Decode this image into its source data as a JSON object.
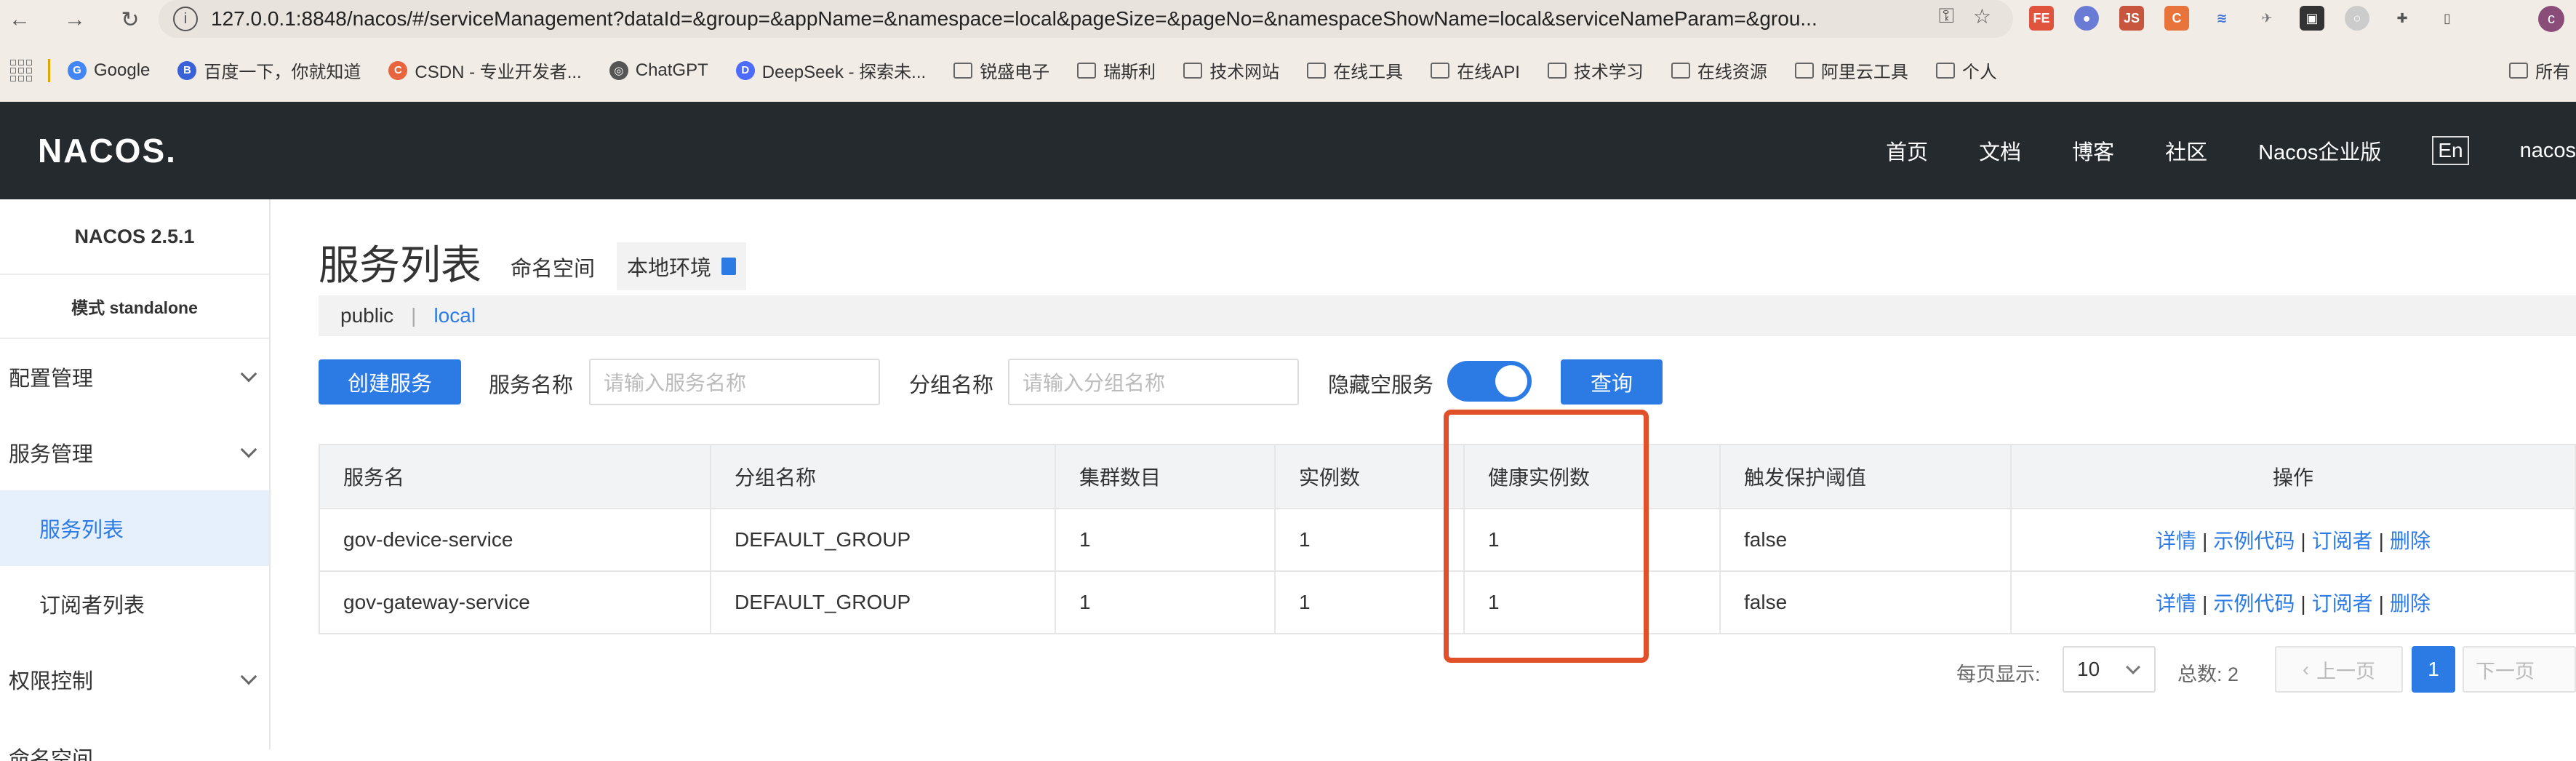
{
  "browser": {
    "url": "127.0.0.1:8848/nacos/#/serviceManagement?dataId=&group=&appName=&namespace=local&pageSize=&pageNo=&namespaceShowName=local&serviceNameParam=&grou...",
    "profile_initial": "c",
    "bookmarks": [
      {
        "label": "Google",
        "kind": "fav",
        "color": "#4285f4",
        "glyph": "G"
      },
      {
        "label": "百度一下，你就知道",
        "kind": "fav",
        "color": "#3a62d8",
        "glyph": "B"
      },
      {
        "label": "CSDN - 专业开发者...",
        "kind": "fav",
        "color": "#e8643c",
        "glyph": "C"
      },
      {
        "label": "ChatGPT",
        "kind": "fav",
        "color": "#555555",
        "glyph": "◎"
      },
      {
        "label": "DeepSeek - 探索未...",
        "kind": "fav",
        "color": "#4d6bfe",
        "glyph": "D"
      },
      {
        "label": "锐盛电子",
        "kind": "folder"
      },
      {
        "label": "瑞斯利",
        "kind": "folder"
      },
      {
        "label": "技术网站",
        "kind": "folder"
      },
      {
        "label": "在线工具",
        "kind": "folder"
      },
      {
        "label": "在线API",
        "kind": "folder"
      },
      {
        "label": "技术学习",
        "kind": "folder"
      },
      {
        "label": "在线资源",
        "kind": "folder"
      },
      {
        "label": "阿里云工具",
        "kind": "folder"
      },
      {
        "label": "个人",
        "kind": "folder"
      }
    ],
    "bookmarks_overflow": "所有"
  },
  "header": {
    "logo": "NACOS.",
    "nav": [
      "首页",
      "文档",
      "博客",
      "社区",
      "Nacos企业版"
    ],
    "lang": "En",
    "user": "nacos"
  },
  "sidebar": {
    "version": "NACOS 2.5.1",
    "mode": "模式 standalone",
    "groups": {
      "config": "配置管理",
      "service": "服务管理",
      "service_list": "服务列表",
      "subscribers": "订阅者列表",
      "auth": "权限控制",
      "namespace": "命名空间"
    }
  },
  "page": {
    "title": "服务列表",
    "ns_label": "命名空间",
    "ns_current": "本地环境",
    "ns_tabs": [
      "public",
      "local"
    ],
    "ns_sep": "|"
  },
  "filters": {
    "create_label": "创建服务",
    "service_name_label": "服务名称",
    "service_name_placeholder": "请输入服务名称",
    "group_name_label": "分组名称",
    "group_name_placeholder": "请输入分组名称",
    "hide_empty_label": "隐藏空服务",
    "hide_empty_on": true,
    "query_label": "查询"
  },
  "table": {
    "columns": [
      "服务名",
      "分组名称",
      "集群数目",
      "实例数",
      "健康实例数",
      "触发保护阈值",
      "操作"
    ],
    "rows": [
      {
        "name": "gov-device-service",
        "group": "DEFAULT_GROUP",
        "clusters": "1",
        "instances": "1",
        "healthy": "1",
        "protect": "false"
      },
      {
        "name": "gov-gateway-service",
        "group": "DEFAULT_GROUP",
        "clusters": "1",
        "instances": "1",
        "healthy": "1",
        "protect": "false"
      }
    ],
    "ops": {
      "detail": "详情",
      "sample": "示例代码",
      "subscriber": "订阅者",
      "delete": "删除",
      "sep": "|"
    }
  },
  "pagination": {
    "page_size_label": "每页显示:",
    "page_size": "10",
    "total_label": "总数: 2",
    "prev": "上一页",
    "next": "下一页",
    "current": "1"
  },
  "colors": {
    "accent": "#2c7be5",
    "header_bg": "#252a2f",
    "highlight": "#e2502a"
  }
}
